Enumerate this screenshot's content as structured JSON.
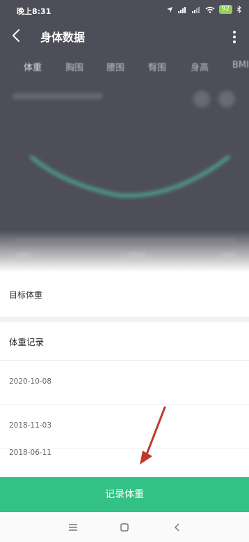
{
  "status_bar": {
    "time": "晚上8:31",
    "battery": "92"
  },
  "header": {
    "title": "身体数据"
  },
  "tabs": [
    {
      "label": "体重",
      "active": true
    },
    {
      "label": "胸围",
      "active": false
    },
    {
      "label": "腰围",
      "active": false
    },
    {
      "label": "臀围",
      "active": false
    },
    {
      "label": "身高",
      "active": false
    },
    {
      "label": "BMI",
      "active": false
    }
  ],
  "goal": {
    "label": "目标体重",
    "value": ""
  },
  "records": {
    "title": "体重记录",
    "items": [
      {
        "date": "2020-10-08",
        "weight": ""
      },
      {
        "date": "2018-11-03",
        "weight": ""
      },
      {
        "date": "2018-06-11",
        "weight": ""
      }
    ]
  },
  "record_button": {
    "label": "记录体重"
  },
  "colors": {
    "header_bg": "#4e4e58",
    "accent_green": "#33c185",
    "battery_green": "#8fd14f",
    "annotation_arrow": "#c0392b",
    "chart_line": "#4dd6a6"
  }
}
